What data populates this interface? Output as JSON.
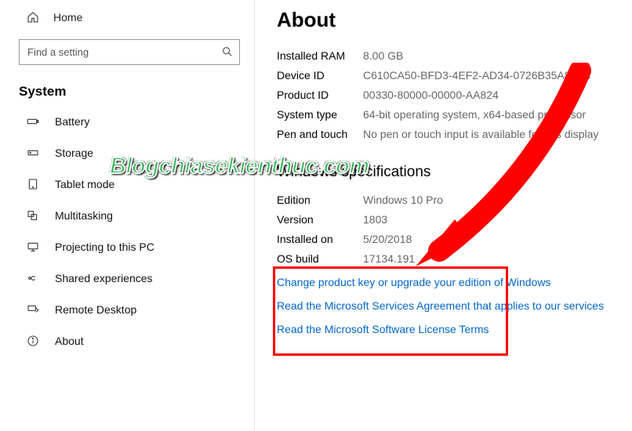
{
  "sidebar": {
    "home_label": "Home",
    "search_placeholder": "Find a setting",
    "section_title": "System",
    "items": [
      {
        "label": "Battery"
      },
      {
        "label": "Storage"
      },
      {
        "label": "Tablet mode"
      },
      {
        "label": "Multitasking"
      },
      {
        "label": "Projecting to this PC"
      },
      {
        "label": "Shared experiences"
      },
      {
        "label": "Remote Desktop"
      },
      {
        "label": "About"
      }
    ]
  },
  "content": {
    "title": "About",
    "device_specs": [
      {
        "label": "Installed RAM",
        "value": "8.00 GB"
      },
      {
        "label": "Device ID",
        "value": "C610CA50-BFD3-4EF2-AD34-0726B35A8C44"
      },
      {
        "label": "Product ID",
        "value": "00330-80000-00000-AA824"
      },
      {
        "label": "System type",
        "value": "64-bit operating system, x64-based processor"
      },
      {
        "label": "Pen and touch",
        "value": "No pen or touch input is available for this display"
      }
    ],
    "win_spec_title": "Windows specifications",
    "win_specs": [
      {
        "label": "Edition",
        "value": "Windows 10 Pro"
      },
      {
        "label": "Version",
        "value": "1803"
      },
      {
        "label": "Installed on",
        "value": "5/20/2018"
      },
      {
        "label": "OS build",
        "value": "17134.191"
      }
    ],
    "links": [
      "Change product key or upgrade your edition of Windows",
      "Read the Microsoft Services Agreement that applies to our services",
      "Read the Microsoft Software License Terms"
    ]
  },
  "overlay": {
    "watermark": "Blogchiasekienthuc.com"
  }
}
